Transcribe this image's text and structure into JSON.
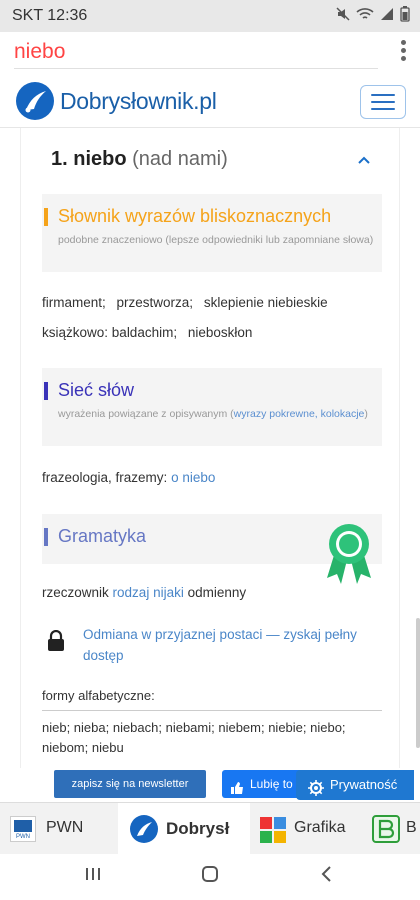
{
  "status_bar": {
    "time": "SKT 12:36"
  },
  "browser": {
    "tab_title": "niebo"
  },
  "site": {
    "logo_text": "Dobrysłownik.pl",
    "brand_color": "#1a5fa8"
  },
  "entry": {
    "number_word": "1. niebo",
    "qualifier": "(nad nami)"
  },
  "sections": {
    "synonyms": {
      "heading": "Słownik wyrazów bliskoznacznych",
      "description": "podobne znaczeniowo (lepsze odpowiedniki lub zapomniane słowa)",
      "color": "#f5a31a",
      "row1": [
        "firmament;",
        "przestworza;",
        "sklepienie niebieskie"
      ],
      "row2_prefix": "książkowo:",
      "row2": [
        "baldachim;",
        "nieboskłon"
      ]
    },
    "word_net": {
      "heading": "Sieć słów",
      "description_before": "wyrażenia powiązane z opisywanym (",
      "description_link": "wyrazy pokrewne, kolokacje",
      "description_after": ")",
      "color": "#3a33b8",
      "phrase_label": "frazeologia, frazemy:",
      "phrase_link": "o niebo"
    },
    "grammar": {
      "heading": "Gramatyka",
      "color": "#6677c4",
      "pos_word": "rzeczownik",
      "gender_link": "rodzaj nijaki",
      "inflection": "odmienny",
      "declension_link": "Odmiana w przyjaznej postaci — zyskaj pełny dostęp",
      "forms_label": "formy alfabetyczne:",
      "forms_text": "nieb; nieba; niebach; niebami; niebem; niebie; niebo; niebom; niebu"
    }
  },
  "actions": {
    "newsletter": "zapisz się na newsletter",
    "like": "Lubię to",
    "privacy": "Prywatność"
  },
  "partner_tabs": [
    {
      "label": "PWN"
    },
    {
      "label": "Dobrysł"
    },
    {
      "label": "Grafika"
    },
    {
      "label": "B"
    }
  ]
}
